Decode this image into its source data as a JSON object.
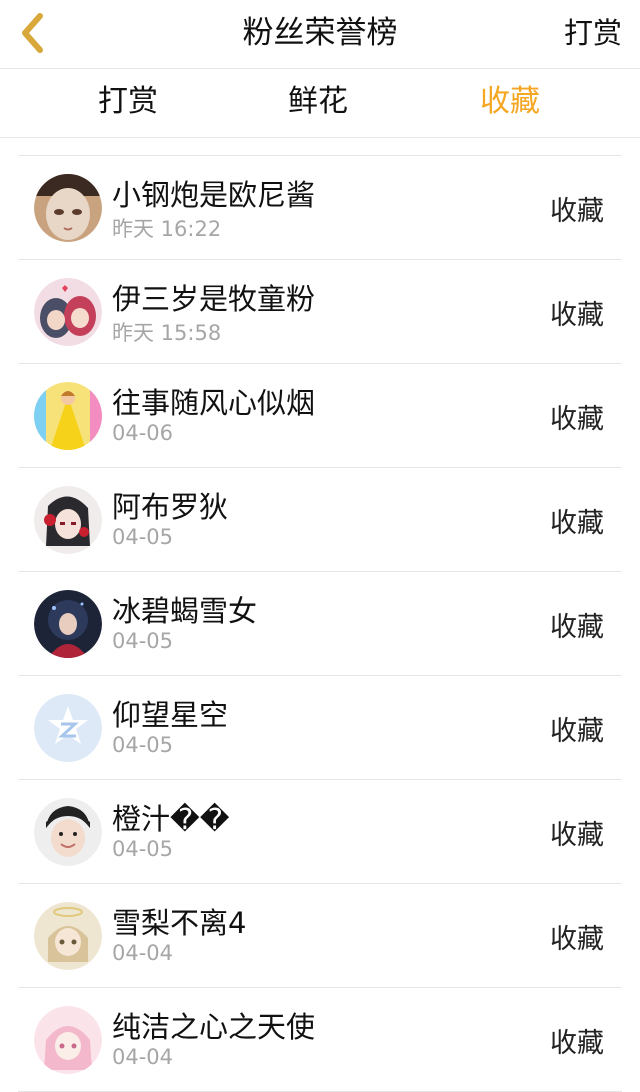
{
  "header": {
    "title": "粉丝荣誉榜",
    "right_action": "打赏",
    "back_icon": "chevron-left-icon"
  },
  "colors": {
    "accent": "#f5a623",
    "text": "#111111",
    "muted": "#a6a6a6",
    "divider": "#e6e6e6"
  },
  "tabs": [
    {
      "label": "打赏",
      "active": false
    },
    {
      "label": "鲜花",
      "active": false
    },
    {
      "label": "收藏",
      "active": true
    }
  ],
  "list": [
    {
      "name": "小钢炮是欧尼酱",
      "time": "昨天 16:22",
      "action": "收藏"
    },
    {
      "name": "伊三岁是牧童粉",
      "time": "昨天 15:58",
      "action": "收藏"
    },
    {
      "name": "往事随风心似烟",
      "time": "04-06",
      "action": "收藏"
    },
    {
      "name": "阿布罗狄",
      "time": "04-05",
      "action": "收藏"
    },
    {
      "name": "冰碧蝎雪女",
      "time": "04-05",
      "action": "收藏"
    },
    {
      "name": "仰望星空",
      "time": "04-05",
      "action": "收藏"
    },
    {
      "name": "橙汁��",
      "time": "04-05",
      "action": "收藏"
    },
    {
      "name": "雪梨不离4",
      "time": "04-04",
      "action": "收藏"
    },
    {
      "name": "纯洁之心之天使",
      "time": "04-04",
      "action": "收藏"
    }
  ]
}
